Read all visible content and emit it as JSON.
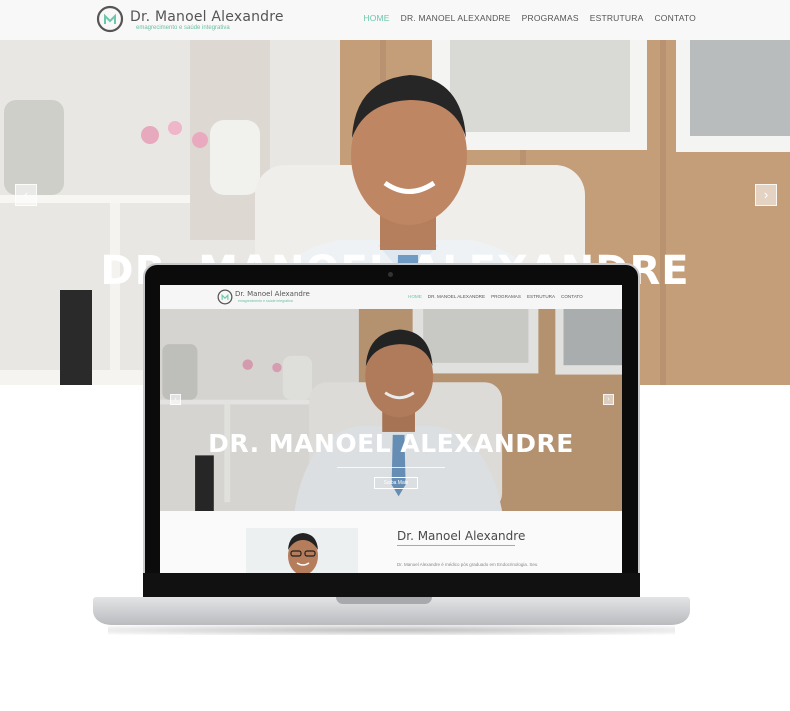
{
  "brand": {
    "name": "Dr. Manoel Alexandre",
    "tagline": "emagrecimento e saúde integrativa",
    "accent": "#6cc7ac"
  },
  "nav": {
    "items": [
      {
        "label": "HOME",
        "active": true
      },
      {
        "label": "DR. MANOEL ALEXANDRE",
        "active": false
      },
      {
        "label": "PROGRAMAS",
        "active": false
      },
      {
        "label": "ESTRUTURA",
        "active": false
      },
      {
        "label": "CONTATO",
        "active": false
      }
    ]
  },
  "hero": {
    "title": "DR. MANOEL ALEXANDRE",
    "prev_icon": "chevron-left-icon",
    "next_icon": "chevron-right-icon",
    "prev_symbol": "‹",
    "next_symbol": "›"
  },
  "screen": {
    "hero_button": "Saiba Mais",
    "about_title": "Dr. Manoel Alexandre",
    "about_text": "Dr. Manoel Alexandre é médico pós graduado em Endocrinologia. Seu"
  }
}
